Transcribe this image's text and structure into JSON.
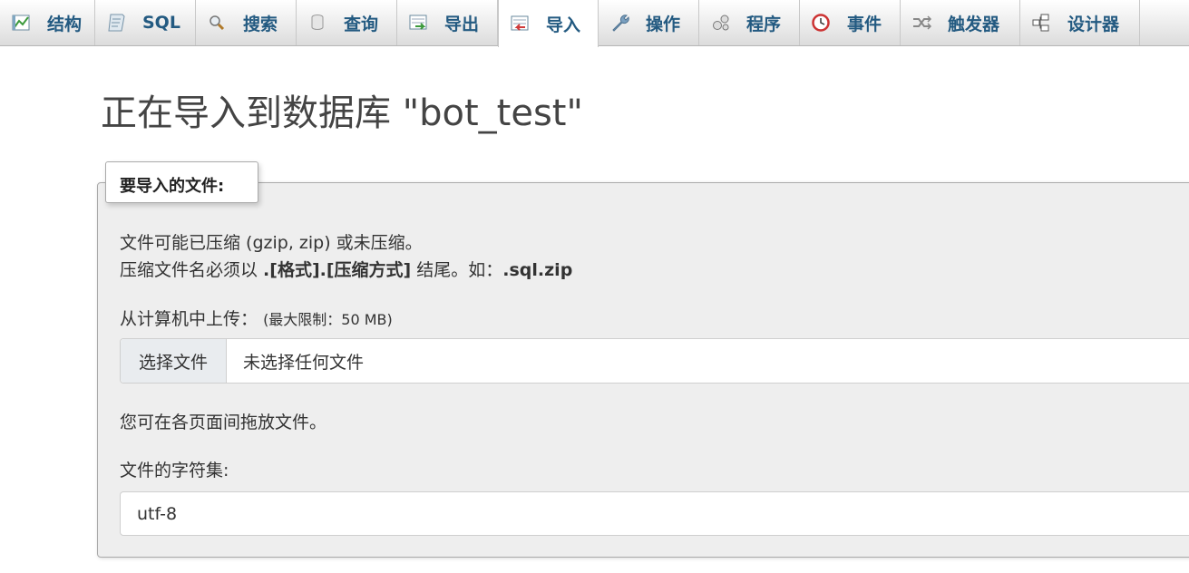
{
  "tabs": [
    {
      "label": "结构",
      "icon": "structure-icon"
    },
    {
      "label": "SQL",
      "icon": "sql-icon"
    },
    {
      "label": "搜索",
      "icon": "search-icon"
    },
    {
      "label": "查询",
      "icon": "query-icon"
    },
    {
      "label": "导出",
      "icon": "export-icon"
    },
    {
      "label": "导入",
      "icon": "import-icon",
      "active": true
    },
    {
      "label": "操作",
      "icon": "wrench-icon"
    },
    {
      "label": "程序",
      "icon": "routines-icon"
    },
    {
      "label": "事件",
      "icon": "clock-icon"
    },
    {
      "label": "触发器",
      "icon": "triggers-icon"
    },
    {
      "label": "设计器",
      "icon": "designer-icon"
    }
  ],
  "page": {
    "title": "正在导入到数据库 \"bot_test\""
  },
  "file_section": {
    "legend": "要导入的文件:",
    "compress_note_1": "文件可能已压缩 (gzip, zip) 或未压缩。",
    "compress_note_2_prefix": "压缩文件名必须以 ",
    "compress_note_2_format": ".[格式].[压缩方式]",
    "compress_note_2_middle": " 结尾。如：",
    "compress_note_2_example": ".sql.zip",
    "upload_label": "从计算机中上传：",
    "upload_limit": "(最大限制：50 MB)",
    "choose_file_button": "选择文件",
    "no_file_chosen": "未选择任何文件",
    "drag_note": "您可在各页面间拖放文件。",
    "charset_label": "文件的字符集:",
    "charset_value": "utf-8"
  },
  "colors": {
    "tab_text": "#235a81",
    "panel_bg": "#eeeeee"
  }
}
